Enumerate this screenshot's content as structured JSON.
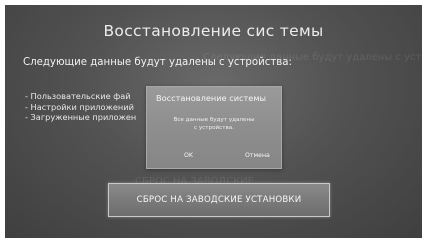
{
  "screen": {
    "title": "Восстановление сис темы",
    "subtitle": "Следующие данные будут удалены с устройства:",
    "subtitle_ghost": "Следующие данные будут удалены с устройства",
    "items": [
      "- Пользовательские фай",
      "- Настройки приложений",
      "- Загруженные приложен"
    ],
    "reset_button_label": "СБРОС НА ЗАВОДСКИЕ УСТАНОВКИ",
    "reset_ghost": "СБРОС НА ЗАВОДСКИЕ"
  },
  "dialog": {
    "title": "Восстановление системы",
    "body": "Все данные будут удалены\nс устройства.",
    "ok_label": "OK",
    "cancel_label": "Отмена"
  }
}
